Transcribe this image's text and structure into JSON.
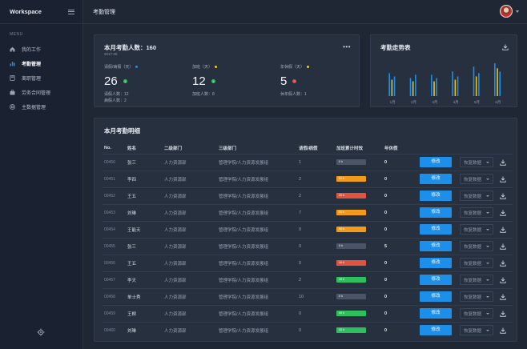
{
  "sidebar": {
    "brand": "Workspace",
    "menu_label": "MENU",
    "items": [
      {
        "label": "我的工作",
        "icon": "home-icon"
      },
      {
        "label": "考勤管理",
        "icon": "bar-chart-icon"
      },
      {
        "label": "离职管理",
        "icon": "calculator-icon"
      },
      {
        "label": "劳务合同管理",
        "icon": "briefcase-icon"
      },
      {
        "label": "主数据管理",
        "icon": "lifebuoy-icon"
      }
    ],
    "active_index": 1
  },
  "topbar": {
    "title": "考勤管理"
  },
  "stats": {
    "title": "本月考勤人数：160",
    "date": "2017-06",
    "items": [
      {
        "label": "请假/病假（天）",
        "dot": "#1e8fe8",
        "value": "26",
        "badge": "#2fbf5e",
        "sub1": "请假人数：12",
        "sub2": "病假人数：2"
      },
      {
        "label": "加班（天）",
        "dot": "#f5c518",
        "value": "12",
        "badge": "#2fbf5e",
        "sub1": "加班人数：8",
        "sub2": ""
      },
      {
        "label": "年休假（天）",
        "dot": "#f5c518",
        "value": "5",
        "badge": "#e04b4b",
        "sub1": "休年假人数：1",
        "sub2": ""
      }
    ]
  },
  "trend": {
    "title": "考勤走势表"
  },
  "chart_data": {
    "type": "bar",
    "categories": [
      "1月",
      "2月",
      "3月",
      "4月",
      "5月",
      "6月"
    ],
    "series": [
      {
        "values": [
          28,
          22,
          26,
          30,
          36,
          40
        ],
        "color": "#1e8fe8"
      },
      {
        "values": [
          20,
          18,
          18,
          20,
          24,
          34
        ],
        "color": "#f5c518"
      },
      {
        "values": [
          24,
          26,
          22,
          24,
          28,
          30
        ],
        "color": "#1e8fe8"
      }
    ],
    "ylim": [
      0,
      45
    ]
  },
  "detail": {
    "title": "本月考勤明细",
    "columns": [
      "No.",
      "姓名",
      "二级部门",
      "三级部门",
      "请假/病假",
      "加班累计时效",
      "年休假",
      "",
      "",
      ""
    ],
    "edit_label": "修改",
    "restore_label": "恢复数据",
    "rows": [
      {
        "no": "00450",
        "name": "张三",
        "dept2": "人力资源部",
        "dept3": "管理学院/人力资源发展组",
        "leave": "1",
        "ot": "0 h",
        "ot_color": "#4a5466",
        "annual": "0"
      },
      {
        "no": "00451",
        "name": "李四",
        "dept2": "人力资源部",
        "dept3": "管理学院/人力资源发展组",
        "leave": "2",
        "ot": "51 h",
        "ot_color": "#f29a1c",
        "annual": "0"
      },
      {
        "no": "00452",
        "name": "王五",
        "dept2": "人力资源部",
        "dept3": "管理学院/人力资源发展组",
        "leave": "2",
        "ot": "20 h",
        "ot_color": "#e0533e",
        "annual": "0"
      },
      {
        "no": "00453",
        "name": "刘琳",
        "dept2": "人力资源部",
        "dept3": "管理学院/人力资源发展组",
        "leave": "7",
        "ot": "60 h",
        "ot_color": "#f29a1c",
        "annual": "0"
      },
      {
        "no": "00454",
        "name": "王能天",
        "dept2": "人力资源部",
        "dept3": "管理学院/人力资源发展组",
        "leave": "0",
        "ot": "50 h",
        "ot_color": "#f29a1c",
        "annual": "0"
      },
      {
        "no": "00455",
        "name": "张三",
        "dept2": "人力资源部",
        "dept3": "管理学院/人力资源发展组",
        "leave": "0",
        "ot": "0 h",
        "ot_color": "#4a5466",
        "annual": "5"
      },
      {
        "no": "00456",
        "name": "王五",
        "dept2": "人力资源部",
        "dept3": "管理学院/人力资源发展组",
        "leave": "0",
        "ot": "10 h",
        "ot_color": "#e0533e",
        "annual": "0"
      },
      {
        "no": "00457",
        "name": "李天",
        "dept2": "人力资源部",
        "dept3": "管理学院/人力资源发展组",
        "leave": "2",
        "ot": "40 h",
        "ot_color": "#2fbf5e",
        "annual": "0"
      },
      {
        "no": "00458",
        "name": "单士秀",
        "dept2": "人力资源部",
        "dept3": "管理学院/人力资源发展组",
        "leave": "10",
        "ot": "0 h",
        "ot_color": "#4a5466",
        "annual": "0"
      },
      {
        "no": "00459",
        "name": "王柳",
        "dept2": "人力资源部",
        "dept3": "管理学院/人力资源发展组",
        "leave": "0",
        "ot": "40 h",
        "ot_color": "#2fbf5e",
        "annual": "0"
      },
      {
        "no": "00460",
        "name": "刘琳",
        "dept2": "人力资源部",
        "dept3": "管理学院/人力资源发展组",
        "leave": "0",
        "ot": "40 h",
        "ot_color": "#2fbf5e",
        "annual": "0"
      }
    ]
  }
}
